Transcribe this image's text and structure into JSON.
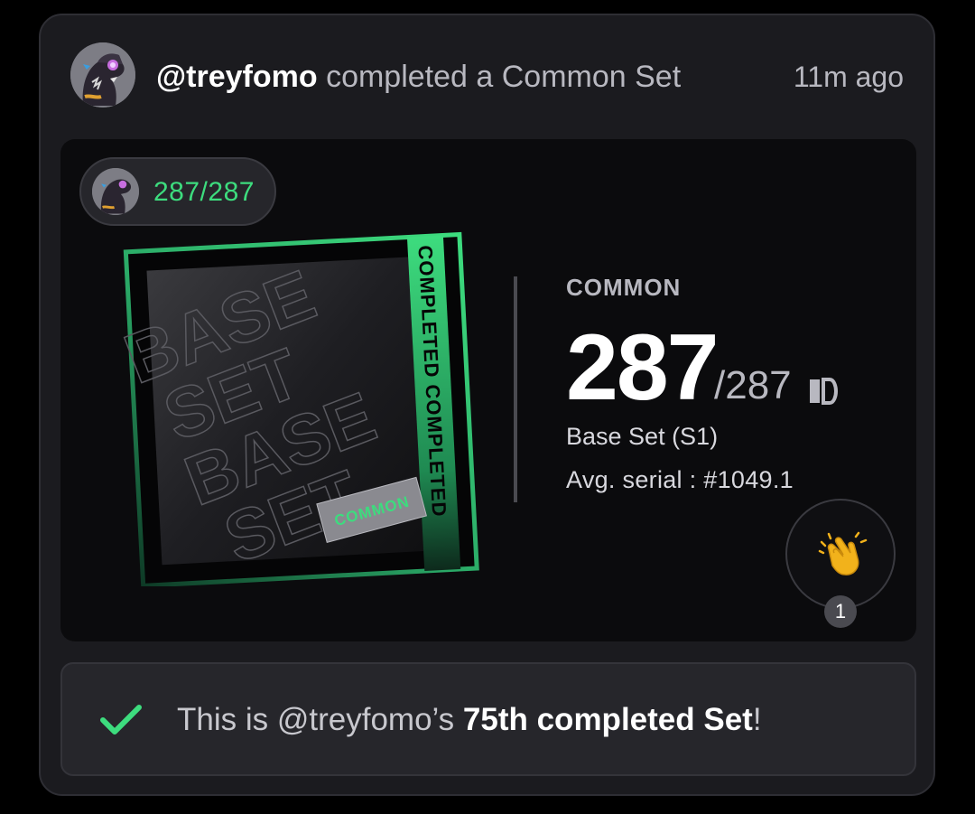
{
  "post": {
    "username": "@treyfomo",
    "action": " completed a Common Set",
    "time": "11m ago",
    "avatar_icon": "dinosaur-avatar"
  },
  "panel": {
    "pill_count": "287/287",
    "set_card": {
      "completed_label": "COMPLETED COMPLETED",
      "watermark_lines": [
        "BASE",
        "SET",
        "BASE",
        "SET"
      ],
      "tag": "COMMON",
      "accent": "#3ddc7e"
    },
    "rarity": "COMMON",
    "count": "287",
    "total": "/287",
    "set_name": "Base Set (S1)",
    "avg_serial": "Avg. serial : #1049.1",
    "reaction": {
      "icon": "clapping-hands-icon",
      "count": "1"
    }
  },
  "banner": {
    "prefix": "This is @treyfomo’s ",
    "highlight": "75th completed Set",
    "suffix": "!",
    "check_color": "#3ddc7e"
  }
}
